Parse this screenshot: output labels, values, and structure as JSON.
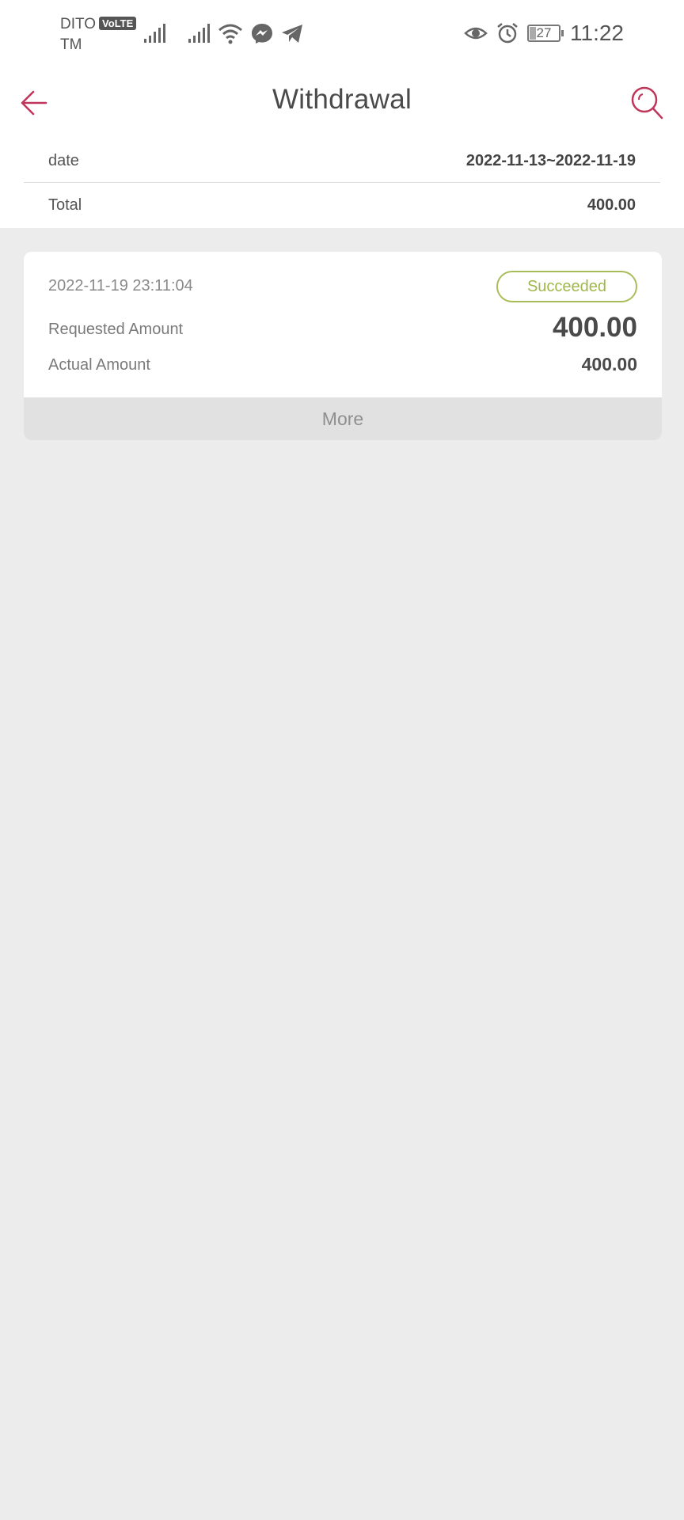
{
  "status_bar": {
    "carrier_line1": "DITO",
    "volte_badge": "VoLTE",
    "carrier_line2": "TM",
    "battery_level": "27",
    "time": "11:22",
    "icons": [
      "signal-icon",
      "signal-icon",
      "wifi-icon",
      "messenger-icon",
      "telegram-icon",
      "eye-icon",
      "alarm-icon",
      "battery-icon"
    ]
  },
  "header": {
    "title": "Withdrawal",
    "back_icon": "arrow-left-icon",
    "search_icon": "search-icon",
    "accent_color": "#c0355a"
  },
  "summary": {
    "date_label": "date",
    "date_value": "2022-11-13~2022-11-19",
    "total_label": "Total",
    "total_value": "400.00"
  },
  "records": [
    {
      "datetime": "2022-11-19 23:11:04",
      "status": "Succeeded",
      "status_color": "#a8bd5a",
      "requested_label": "Requested Amount",
      "requested_value": "400.00",
      "actual_label": "Actual Amount",
      "actual_value": "400.00"
    }
  ],
  "more_label": "More"
}
